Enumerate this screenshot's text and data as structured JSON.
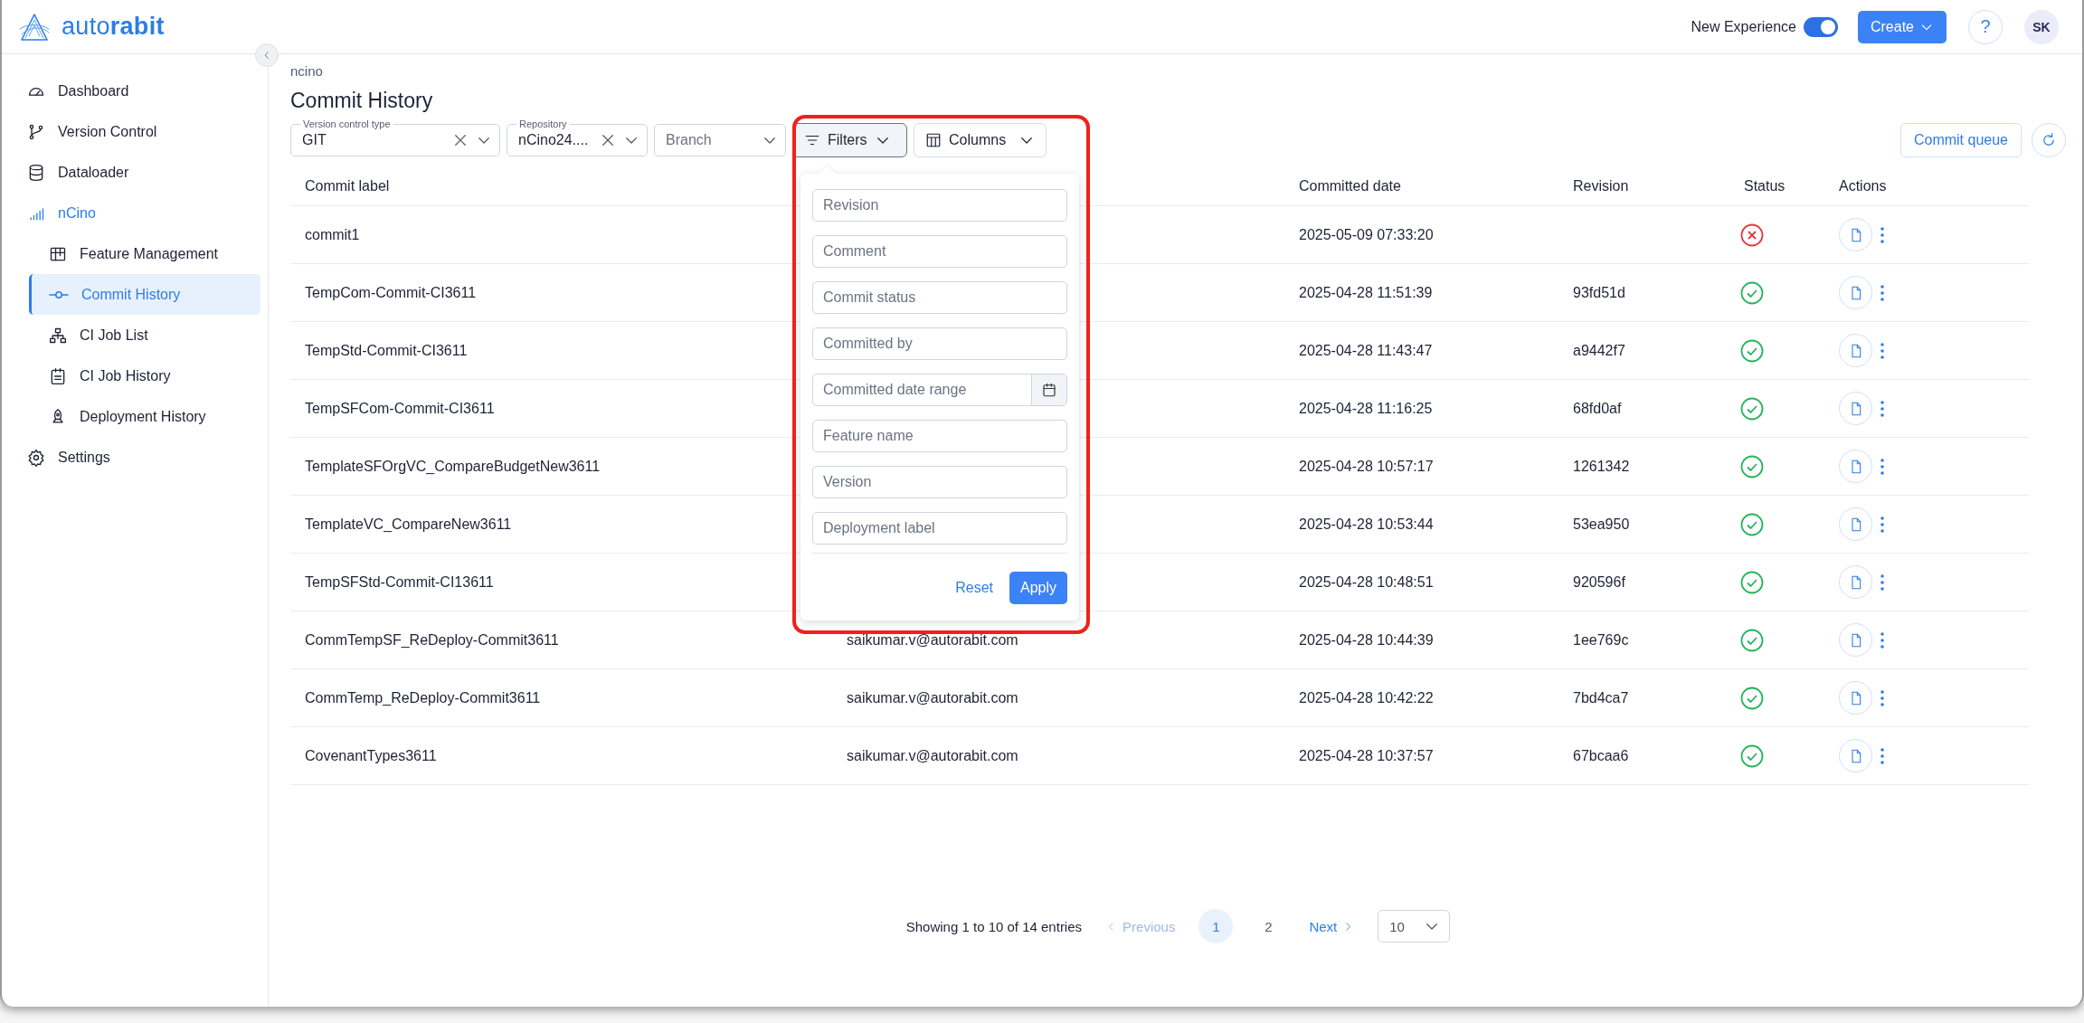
{
  "header": {
    "logo": "auto**rabit**",
    "toggle": {
      "label": "New Experience",
      "on": true
    },
    "create_button": "Create",
    "help_button": "?",
    "avatar": "SK"
  },
  "sidebar": {
    "items": [
      {
        "label": "Dashboard",
        "selected": false
      },
      {
        "label": "Version Control",
        "selected": false
      },
      {
        "label": "Dataloader",
        "selected": false
      },
      {
        "label": "nCino",
        "selected": false,
        "expanded": true,
        "children": [
          {
            "label": "Feature Management",
            "selected": false
          },
          {
            "label": "Commit History",
            "selected": true
          },
          {
            "label": "CI Job List",
            "selected": false
          },
          {
            "label": "CI Job History",
            "selected": false
          },
          {
            "label": "Deployment History",
            "selected": false
          }
        ]
      },
      {
        "label": "Settings",
        "selected": false
      }
    ]
  },
  "breadcrumb": "ncino",
  "title": "Commit History",
  "selects": [
    {
      "label": "Version control type",
      "value": "GIT",
      "clearable": true
    },
    {
      "label": "Repository",
      "value": "nCino24....",
      "clearable": true
    },
    {
      "placeholder": "Branch",
      "clearable": false
    }
  ],
  "filters_button": {
    "label": "Filters",
    "expanded": true
  },
  "columns_button": "Columns",
  "commit_queue_button": "Commit queue",
  "filter_panel": {
    "fields": [
      {
        "placeholder": "Revision",
        "kind": "text"
      },
      {
        "placeholder": "Comment",
        "kind": "text"
      },
      {
        "placeholder": "Commit status",
        "kind": "text"
      },
      {
        "placeholder": "Committed by",
        "kind": "text"
      },
      {
        "placeholder": "Committed date range",
        "kind": "date"
      },
      {
        "placeholder": "Feature name",
        "kind": "text"
      },
      {
        "placeholder": "Version",
        "kind": "text"
      },
      {
        "placeholder": "Deployment label",
        "kind": "text"
      }
    ],
    "reset": "Reset",
    "apply": "Apply"
  },
  "table": {
    "columns": [
      "Commit label",
      "Committed date",
      "Revision",
      "Status",
      "Actions"
    ],
    "rows": [
      {
        "commit_label": "commit1",
        "committed_date": "2025-05-09 07:33:20",
        "kind": "failed"
      },
      {
        "commit_label": "TempCom-Commit-CI3611",
        "committed_date": "2025-04-28 11:51:39",
        "revision": "93fd51d",
        "kind": "success"
      },
      {
        "commit_label": "TempStd-Commit-CI3611",
        "committed_date": "2025-04-28 11:43:47",
        "revision": "a9442f7",
        "kind": "success"
      },
      {
        "commit_label": "TempSFCom-Commit-CI3611",
        "committed_date": "2025-04-28 11:16:25",
        "revision": "68fd0af",
        "kind": "success"
      },
      {
        "commit_label": "TemplateSFOrgVC_CompareBudgetNew3611",
        "committed_date": "2025-04-28 10:57:17",
        "revision": "1261342",
        "kind": "success"
      },
      {
        "commit_label": "TemplateVC_CompareNew3611",
        "committed_date": "2025-04-28 10:53:44",
        "revision": "53ea950",
        "kind": "success"
      },
      {
        "commit_label": "TempSFStd-Commit-CI13611",
        "committed_date": "2025-04-28 10:48:51",
        "revision": "920596f",
        "kind": "success"
      },
      {
        "commit_label": "CommTempSF_ReDeploy-Commit3611",
        "committed_by": "saikumar.v@autorabit.com",
        "committed_date": "2025-04-28 10:44:39",
        "revision": "1ee769c",
        "kind": "success"
      },
      {
        "commit_label": "CommTemp_ReDeploy-Commit3611",
        "committed_by": "saikumar.v@autorabit.com",
        "committed_date": "2025-04-28 10:42:22",
        "revision": "7bd4ca7",
        "kind": "success"
      },
      {
        "commit_label": "CovenantTypes3611",
        "committed_by": "saikumar.v@autorabit.com",
        "committed_date": "2025-04-28 10:37:57",
        "revision": "67bcaa6",
        "kind": "success"
      }
    ]
  },
  "pagination": {
    "summary": "Showing 1 to 10 of 14 entries",
    "previous": {
      "label": "Previous",
      "disabled": true
    },
    "pages": [
      {
        "label": "1",
        "selected": true
      },
      {
        "label": "2",
        "selected": false
      }
    ],
    "next": {
      "label": "Next",
      "disabled": false
    },
    "page_size": "10"
  }
}
